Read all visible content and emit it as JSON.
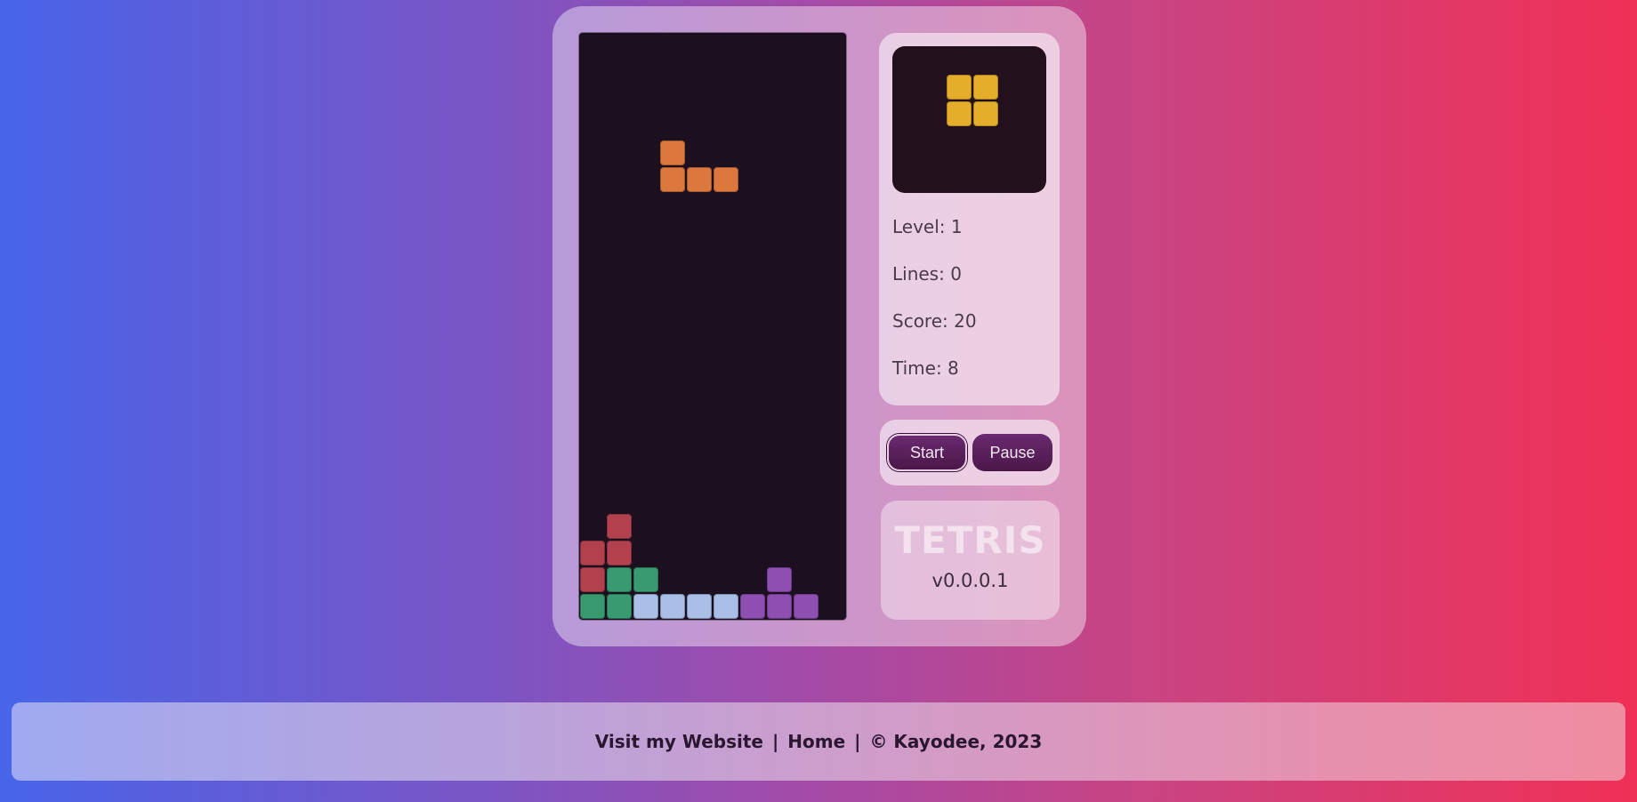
{
  "game": {
    "title": "TETRIS",
    "version": "v0.0.0.1"
  },
  "stats": {
    "level": "Level: 1",
    "lines": "Lines: 0",
    "score": "Score: 20",
    "time": "Time: 8"
  },
  "controls": {
    "start_label": "Start",
    "pause_label": "Pause"
  },
  "footer": {
    "website_label": "Visit my Website",
    "separator": "|",
    "home_label": "Home",
    "copyright": "© Kayodee, 2023"
  },
  "colors": {
    "orange": "#dc783d",
    "yellow": "#e5ae2a",
    "red": "#b3404d",
    "green": "#389a6e",
    "lightblue": "#a9bfe7",
    "purple": "#8f4fb2"
  },
  "board": {
    "columns": 10,
    "rows": 22,
    "falling_piece": {
      "color": "orange",
      "cells": [
        [
          3,
          4
        ],
        [
          3,
          5
        ],
        [
          4,
          5
        ],
        [
          5,
          5
        ]
      ]
    },
    "stack": [
      {
        "col": 1,
        "row": 18,
        "color": "red"
      },
      {
        "col": 0,
        "row": 19,
        "color": "red"
      },
      {
        "col": 1,
        "row": 19,
        "color": "red"
      },
      {
        "col": 0,
        "row": 20,
        "color": "red"
      },
      {
        "col": 1,
        "row": 20,
        "color": "green"
      },
      {
        "col": 2,
        "row": 20,
        "color": "green"
      },
      {
        "col": 7,
        "row": 20,
        "color": "purple"
      },
      {
        "col": 0,
        "row": 21,
        "color": "green"
      },
      {
        "col": 1,
        "row": 21,
        "color": "green"
      },
      {
        "col": 2,
        "row": 21,
        "color": "lightblue"
      },
      {
        "col": 3,
        "row": 21,
        "color": "lightblue"
      },
      {
        "col": 4,
        "row": 21,
        "color": "lightblue"
      },
      {
        "col": 5,
        "row": 21,
        "color": "lightblue"
      },
      {
        "col": 6,
        "row": 21,
        "color": "purple"
      },
      {
        "col": 7,
        "row": 21,
        "color": "purple"
      },
      {
        "col": 8,
        "row": 21,
        "color": "purple"
      }
    ]
  },
  "next_piece": {
    "color": "yellow",
    "cells": [
      [
        0,
        0
      ],
      [
        1,
        0
      ],
      [
        0,
        1
      ],
      [
        1,
        1
      ]
    ]
  }
}
